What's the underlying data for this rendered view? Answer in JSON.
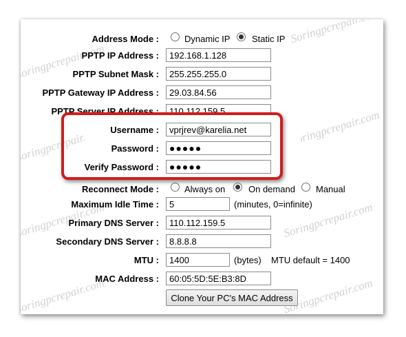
{
  "watermark": "Soringpcrepair.com",
  "address_mode": {
    "label": "Address Mode :",
    "options": [
      "Dynamic IP",
      "Static IP"
    ],
    "selected": "Static IP"
  },
  "fields": {
    "pptp_ip": {
      "label": "PPTP IP Address :",
      "value": "192.168.1.128"
    },
    "pptp_mask": {
      "label": "PPTP Subnet Mask :",
      "value": "255.255.255.0"
    },
    "pptp_gateway": {
      "label": "PPTP Gateway IP Address :",
      "value": "29.03.84.56"
    },
    "pptp_server": {
      "label": "PPTP Server IP Address :",
      "value": "110.112.159.5"
    },
    "username": {
      "label": "Username :",
      "value": "vprjrev@karelia.net"
    },
    "password": {
      "label": "Password :",
      "value": "●●●●●"
    },
    "verify_password": {
      "label": "Verify Password :",
      "value": "●●●●●"
    },
    "max_idle": {
      "label": "Maximum Idle Time :",
      "value": "5",
      "suffix": "(minutes, 0=infinite)"
    },
    "primary_dns": {
      "label": "Primary DNS Server :",
      "value": "110.112.159.5"
    },
    "secondary_dns": {
      "label": "Secondary DNS Server :",
      "value": "8.8.8.8"
    },
    "mtu": {
      "label": "MTU :",
      "value": "1400",
      "suffix": "(bytes)",
      "note": "MTU default = 1400"
    },
    "mac": {
      "label": "MAC Address :",
      "value": "60:05:5D:5E:B3:8D"
    }
  },
  "reconnect_mode": {
    "label": "Reconnect Mode :",
    "options": [
      "Always on",
      "On demand",
      "Manual"
    ],
    "selected": "On demand"
  },
  "clone_button": "Clone Your PC's MAC Address",
  "colors": {
    "highlight": "#d11c1c"
  }
}
